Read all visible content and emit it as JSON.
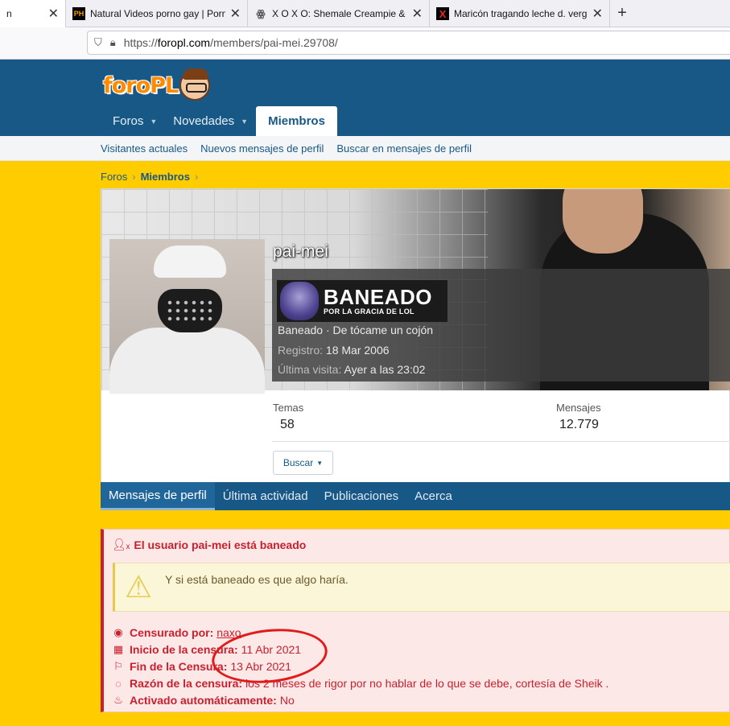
{
  "browser": {
    "tabs": [
      {
        "title": "n",
        "favicon": "",
        "active": true
      },
      {
        "title": "Natural Videos porno gay | Porn",
        "favicon": "PH",
        "active": false
      },
      {
        "title": "X O X O: Shemale Creampie & ...",
        "favicon": "owl-icon",
        "active": false
      },
      {
        "title": "Maricón tragando leche d. verg",
        "favicon": "X",
        "active": false
      }
    ],
    "url_prefix": "https://",
    "url_host": "foropl.com",
    "url_path": "/members/pai-mei.29708/"
  },
  "site": {
    "logo_text": "foroPL",
    "nav": [
      {
        "label": "Foros",
        "has_caret": true
      },
      {
        "label": "Novedades",
        "has_caret": true
      },
      {
        "label": "Miembros",
        "has_caret": false
      }
    ],
    "subnav": [
      "Visitantes actuales",
      "Nuevos mensajes de perfil",
      "Buscar en mensajes de perfil"
    ],
    "breadcrumbs": [
      "Foros",
      "Miembros"
    ]
  },
  "profile": {
    "username": "pai-mei",
    "badge_big": "BANEADO",
    "badge_small": "POR LA GRACIA DE LOL",
    "title_line": "Baneado · De tócame un cojón",
    "registro_label": "Registro:",
    "registro_value": "18 Mar 2006",
    "ultima_label": "Última visita:",
    "ultima_value": "Ayer a las 23:02",
    "temas_label": "Temas",
    "temas_value": "58",
    "mensajes_label": "Mensajes",
    "mensajes_value": "12.779",
    "buscar_label": "Buscar",
    "tabs": [
      "Mensajes de perfil",
      "Última actividad",
      "Publicaciones",
      "Acerca"
    ]
  },
  "ban": {
    "title": "El usuario pai-mei está baneado",
    "quote": "Y si está baneado es que algo haría.",
    "censurado_label": "Censurado por:",
    "censurado_value": "naxo",
    "inicio_label": "Inicio de la censura:",
    "inicio_value": "11 Abr 2021",
    "fin_label": "Fin de la Censura:",
    "fin_value": "13 Abr 2021",
    "razon_label": "Razón de la censura:",
    "razon_value": "los 2 meses de rigor por no hablar de lo que se debe, cortesía de Sheik .",
    "auto_label": "Activado automáticamente:",
    "auto_value": "No"
  },
  "colors": {
    "header": "#185886",
    "page_bg": "#ffcc00",
    "ban_red": "#c8202e",
    "annotation": "#e11a1a"
  }
}
